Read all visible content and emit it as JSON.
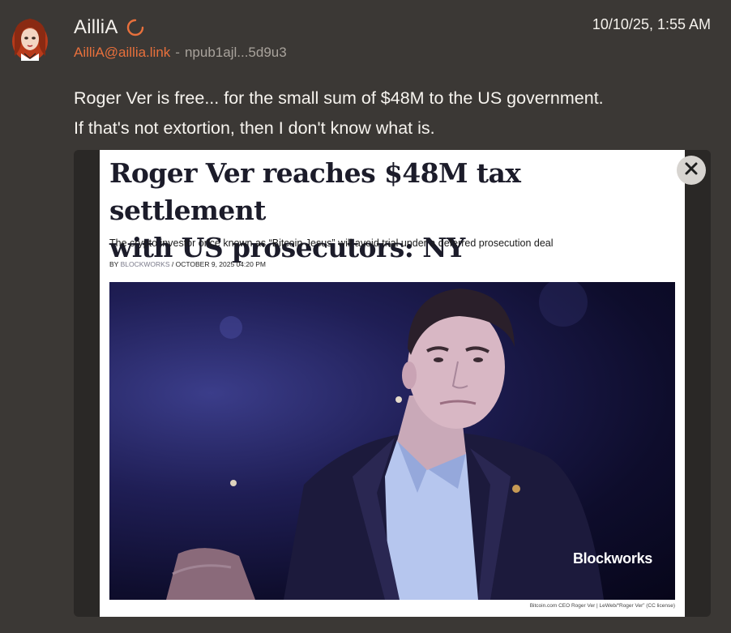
{
  "post": {
    "author_name": "AilliA",
    "nip05": "AilliA@aillia.link",
    "separator": "-",
    "npub": "npub1ajl...5d9u3",
    "timestamp": "10/10/25, 1:55 AM",
    "content_lines": [
      "Roger Ver is free... for the small sum of $48M to the US government.",
      "If that's not extortion, then I don't know what is."
    ]
  },
  "article": {
    "headline_lines": [
      "Roger Ver reaches $48M tax settlement",
      "with US prosecutors: NY"
    ],
    "subtitle": "The crypto investor once known as “Bitcoin Jesus” will avoid trial under a deferred prosecution deal",
    "byline_prefix": "BY",
    "byline_publisher": "BLOCKWORKS",
    "byline_date": "/ OCTOBER 9, 2025 04:20 PM",
    "photo_watermark": "Blockworks",
    "photo_caption": "Bitcoin.com CEO Roger Ver | LeWeb/“Roger Ver” (CC license)"
  },
  "icons": {
    "avatar": "avatar-illustration",
    "loading": "loading-spinner-icon",
    "close": "close-icon"
  },
  "colors": {
    "background": "#3b3835",
    "accent": "#e8703c",
    "headline": "#1c1c2a"
  }
}
